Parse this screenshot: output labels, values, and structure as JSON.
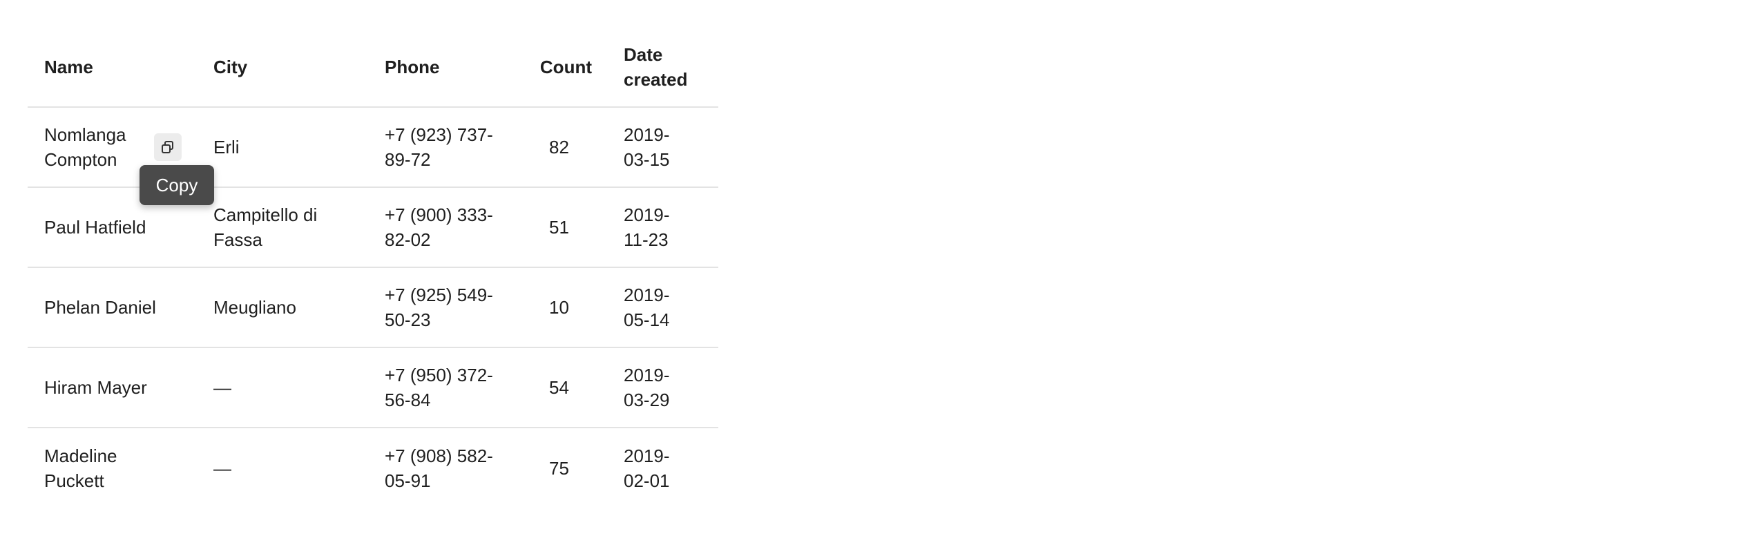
{
  "table": {
    "headers": {
      "name": "Name",
      "city": "City",
      "phone": "Phone",
      "count": "Count",
      "date_created": "Date created"
    },
    "rows": [
      {
        "name": "Nomlanga Compton",
        "city": "Erli",
        "phone": "+7 (923) 737-89-72",
        "count": "82",
        "date": "2019-03-15"
      },
      {
        "name": "Paul Hatfield",
        "city": "Campitello di Fassa",
        "phone": "+7 (900) 333-82-02",
        "count": "51",
        "date": "2019-11-23"
      },
      {
        "name": "Phelan Daniel",
        "city": "Meugliano",
        "phone": "+7 (925) 549-50-23",
        "count": "10",
        "date": "2019-05-14"
      },
      {
        "name": "Hiram Mayer",
        "city": "—",
        "phone": "+7 (950) 372-56-84",
        "count": "54",
        "date": "2019-03-29"
      },
      {
        "name": "Madeline Puckett",
        "city": "—",
        "phone": "+7 (908) 582-05-91",
        "count": "75",
        "date": "2019-02-01"
      }
    ]
  },
  "tooltip": {
    "label": "Copy"
  },
  "icons": {
    "copy": "copy-icon"
  }
}
